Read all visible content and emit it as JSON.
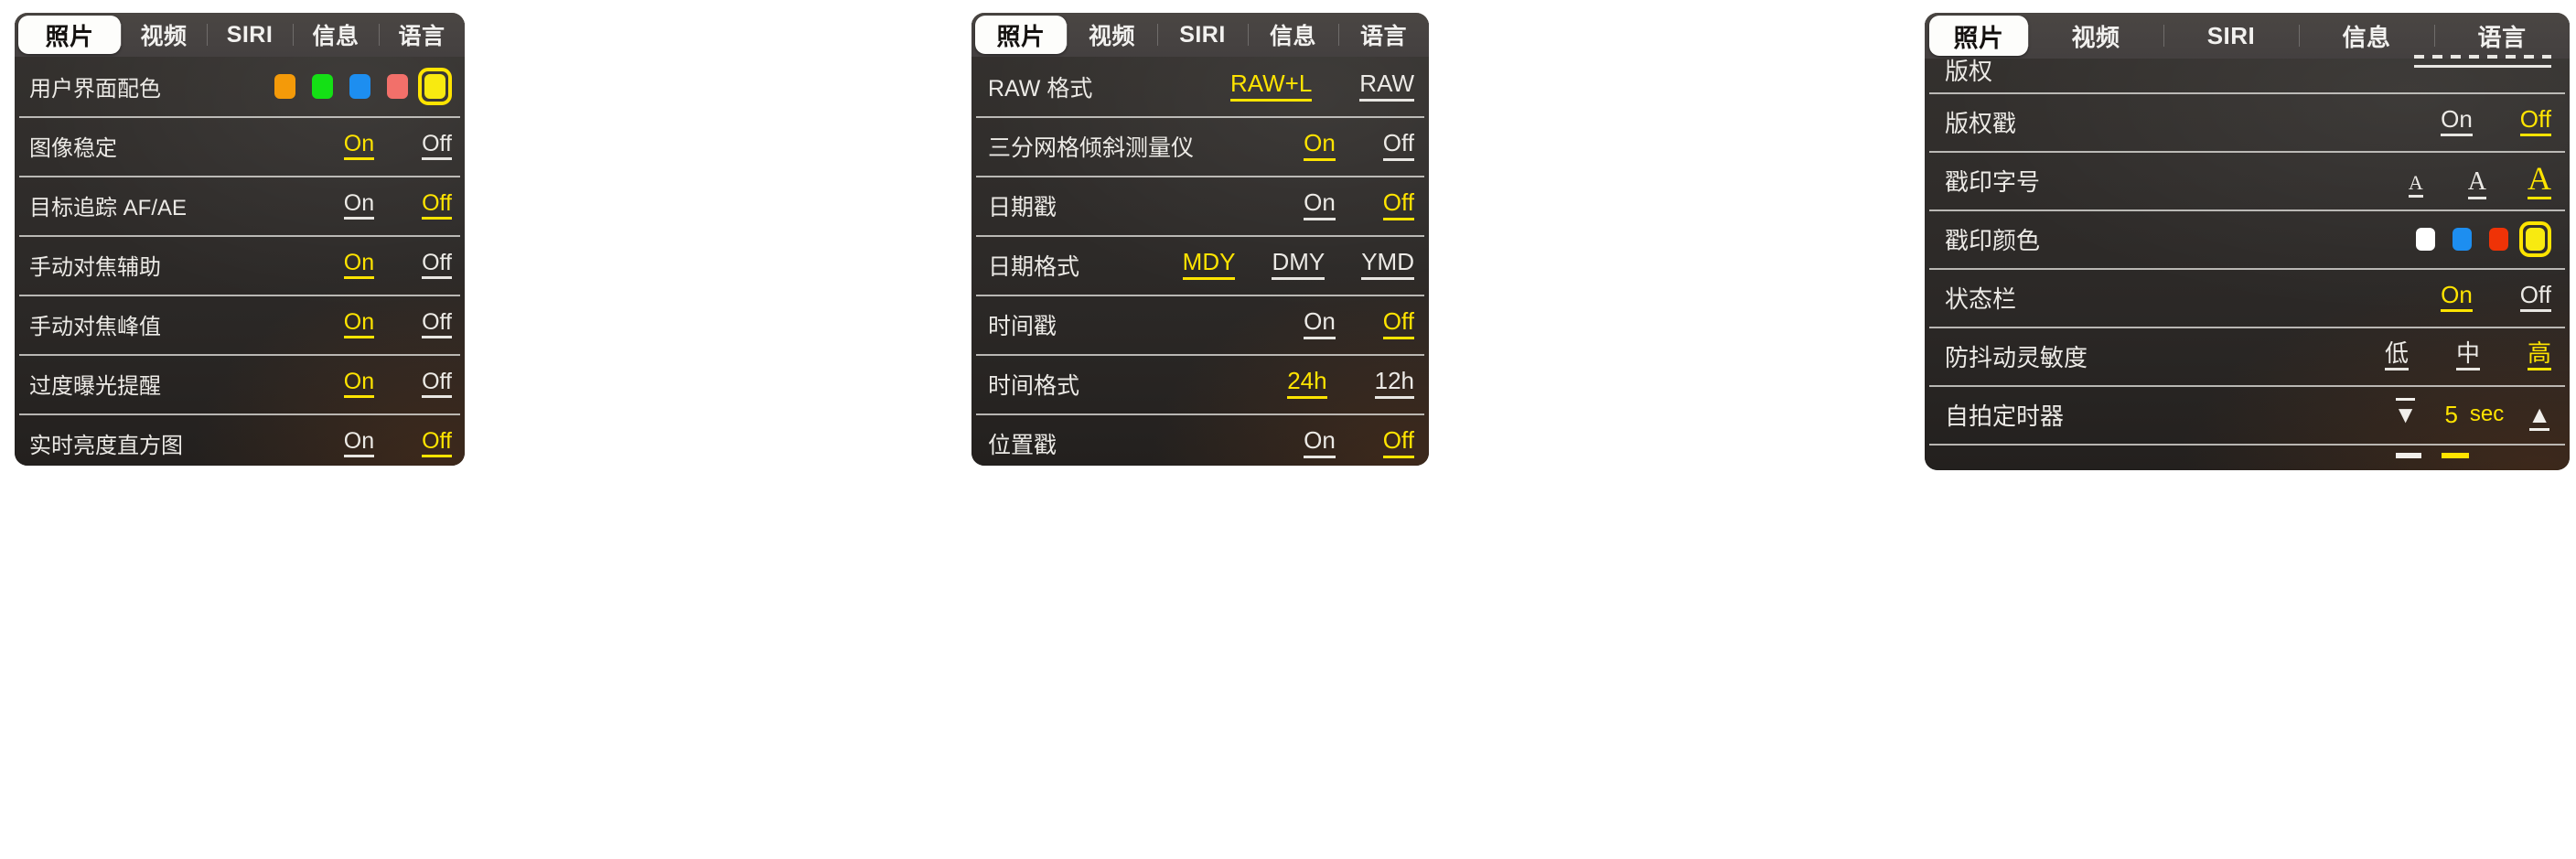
{
  "theme": {
    "accent": "#ffe400",
    "text": "#eceae6",
    "panel_bg": "#2e2c2a",
    "tabbar_bg": "#4a4643",
    "active_tab_bg": "#fdfdfb",
    "divider": "#e2e0dc"
  },
  "tabs": [
    "照片",
    "视频",
    "SIRI",
    "信息",
    "语言"
  ],
  "active_tab": "照片",
  "panels": [
    {
      "id": "panel-1",
      "rows": [
        {
          "label": "用户界面配色",
          "control": "swatches",
          "swatches": [
            {
              "name": "orange",
              "color": "#f49a09",
              "selected": false
            },
            {
              "name": "green",
              "color": "#14e015",
              "selected": false
            },
            {
              "name": "blue",
              "color": "#1d8ef0",
              "selected": false
            },
            {
              "name": "salmon",
              "color": "#f2706a",
              "selected": false
            },
            {
              "name": "yellow",
              "color": "#f8ea10",
              "selected": true
            }
          ]
        },
        {
          "label": "图像稳定",
          "control": "options",
          "options": [
            "On",
            "Off"
          ],
          "selected": "On"
        },
        {
          "label": "目标追踪 AF/AE",
          "control": "options",
          "options": [
            "On",
            "Off"
          ],
          "selected": "Off"
        },
        {
          "label": "手动对焦辅助",
          "control": "options",
          "options": [
            "On",
            "Off"
          ],
          "selected": "On"
        },
        {
          "label": "手动对焦峰值",
          "control": "options",
          "options": [
            "On",
            "Off"
          ],
          "selected": "On"
        },
        {
          "label": "过度曝光提醒",
          "control": "options",
          "options": [
            "On",
            "Off"
          ],
          "selected": "On"
        },
        {
          "label": "实时亮度直方图",
          "control": "options",
          "options": [
            "On",
            "Off"
          ],
          "selected": "Off"
        }
      ]
    },
    {
      "id": "panel-2",
      "rows": [
        {
          "label": "RAW 格式",
          "control": "options",
          "options": [
            "RAW+L",
            "RAW"
          ],
          "selected": "RAW+L"
        },
        {
          "label": "三分网格倾斜测量仪",
          "control": "options",
          "options": [
            "On",
            "Off"
          ],
          "selected": "On"
        },
        {
          "label": "日期戳",
          "control": "options",
          "options": [
            "On",
            "Off"
          ],
          "selected": "Off"
        },
        {
          "label": "日期格式",
          "control": "options",
          "options": [
            "MDY",
            "DMY",
            "YMD"
          ],
          "selected": "MDY"
        },
        {
          "label": "时间戳",
          "control": "options",
          "options": [
            "On",
            "Off"
          ],
          "selected": "Off"
        },
        {
          "label": "时间格式",
          "control": "options",
          "options": [
            "24h",
            "12h"
          ],
          "selected": "24h"
        },
        {
          "label": "位置戳",
          "control": "options",
          "options": [
            "On",
            "Off"
          ],
          "selected": "Off"
        }
      ]
    },
    {
      "id": "panel-3",
      "rows": [
        {
          "label": "版权",
          "control": "dashed",
          "clipped": true
        },
        {
          "label": "版权戳",
          "control": "options",
          "options": [
            "On",
            "Off"
          ],
          "selected": "Off"
        },
        {
          "label": "戳印字号",
          "control": "letters",
          "letters": [
            {
              "text": "A",
              "size": 22,
              "selected": false
            },
            {
              "text": "A",
              "size": 28,
              "selected": false
            },
            {
              "text": "A",
              "size": 36,
              "selected": true
            }
          ]
        },
        {
          "label": "戳印颜色",
          "control": "swatches",
          "swatches": [
            {
              "name": "white",
              "color": "#ffffff",
              "selected": false
            },
            {
              "name": "blue",
              "color": "#1d8ef0",
              "selected": false
            },
            {
              "name": "red",
              "color": "#ef3307",
              "selected": false
            },
            {
              "name": "yellow",
              "color": "#f8ea10",
              "selected": true
            }
          ]
        },
        {
          "label": "状态栏",
          "control": "options",
          "options": [
            "On",
            "Off"
          ],
          "selected": "On"
        },
        {
          "label": "防抖动灵敏度",
          "control": "options",
          "options": [
            "低",
            "中",
            "高"
          ],
          "selected": "高"
        },
        {
          "label": "自拍定时器",
          "control": "stepper",
          "decrement": "▼",
          "increment": "▲",
          "value": "5",
          "unit": "sec"
        },
        {
          "label": "",
          "control": "tail",
          "tail": true
        }
      ]
    }
  ]
}
